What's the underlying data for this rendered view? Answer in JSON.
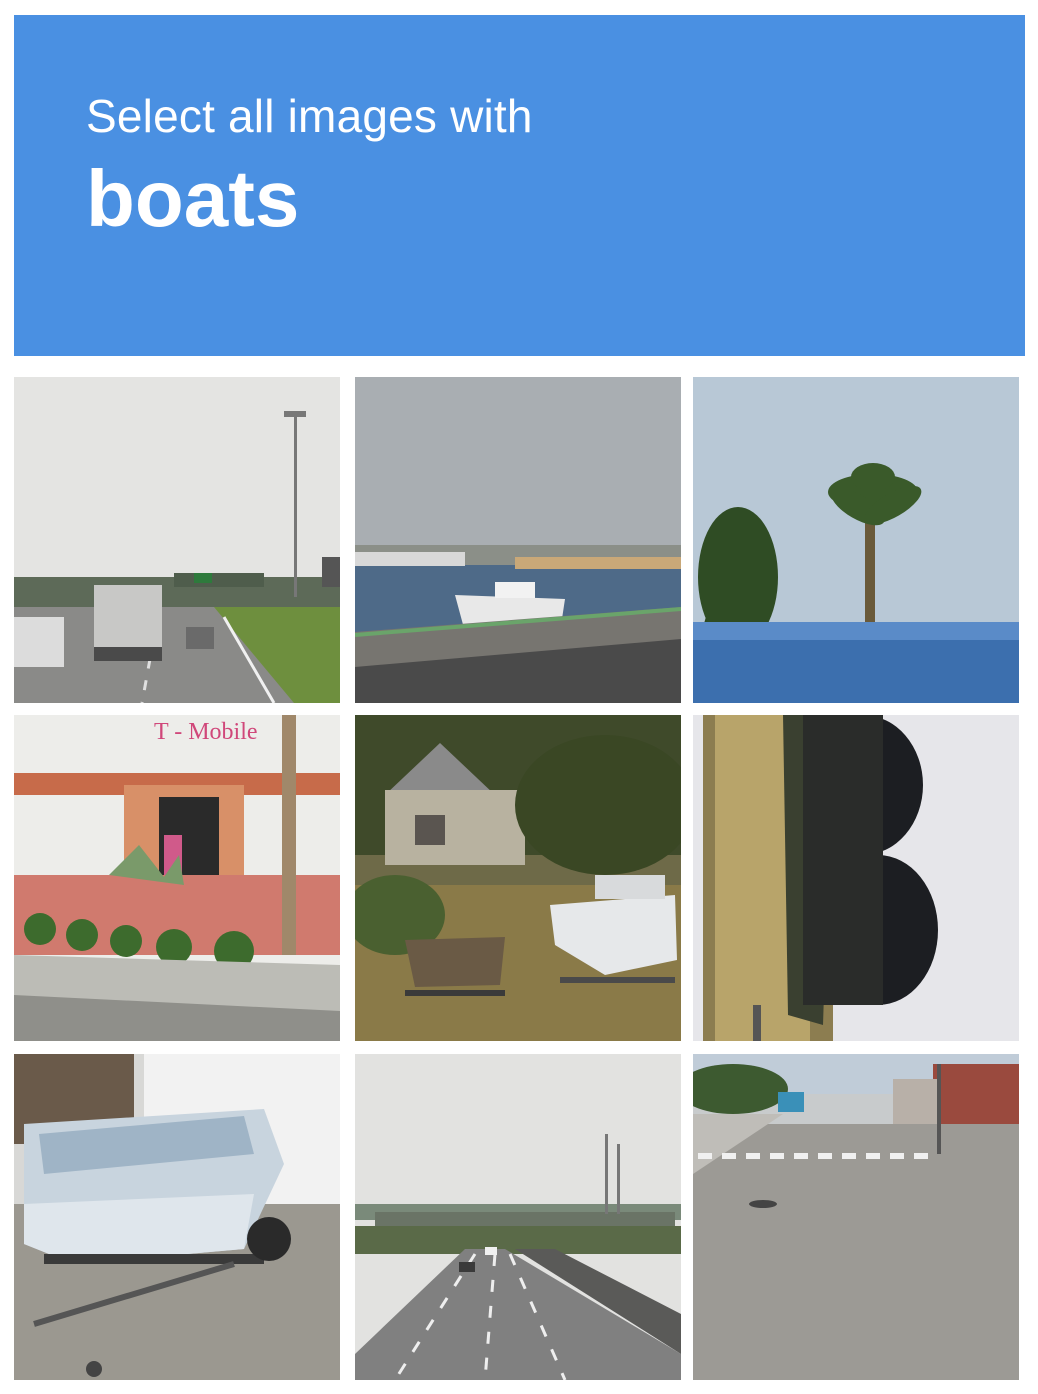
{
  "header": {
    "instruction": "Select all images with",
    "target": "boats",
    "background_color": "#4a90e2"
  },
  "tiles": [
    {
      "content": "highway with trucks and light pole"
    },
    {
      "content": "harbor with white ship"
    },
    {
      "content": "palm tree and blue railing"
    },
    {
      "content": "T-Mobile storefront",
      "sign_text": "T - Mobile"
    },
    {
      "content": "two boats on trailers in yard"
    },
    {
      "content": "traffic light"
    },
    {
      "content": "boat on trailer in driveway"
    },
    {
      "content": "freeway with overpass"
    },
    {
      "content": "street with crosswalk"
    }
  ]
}
